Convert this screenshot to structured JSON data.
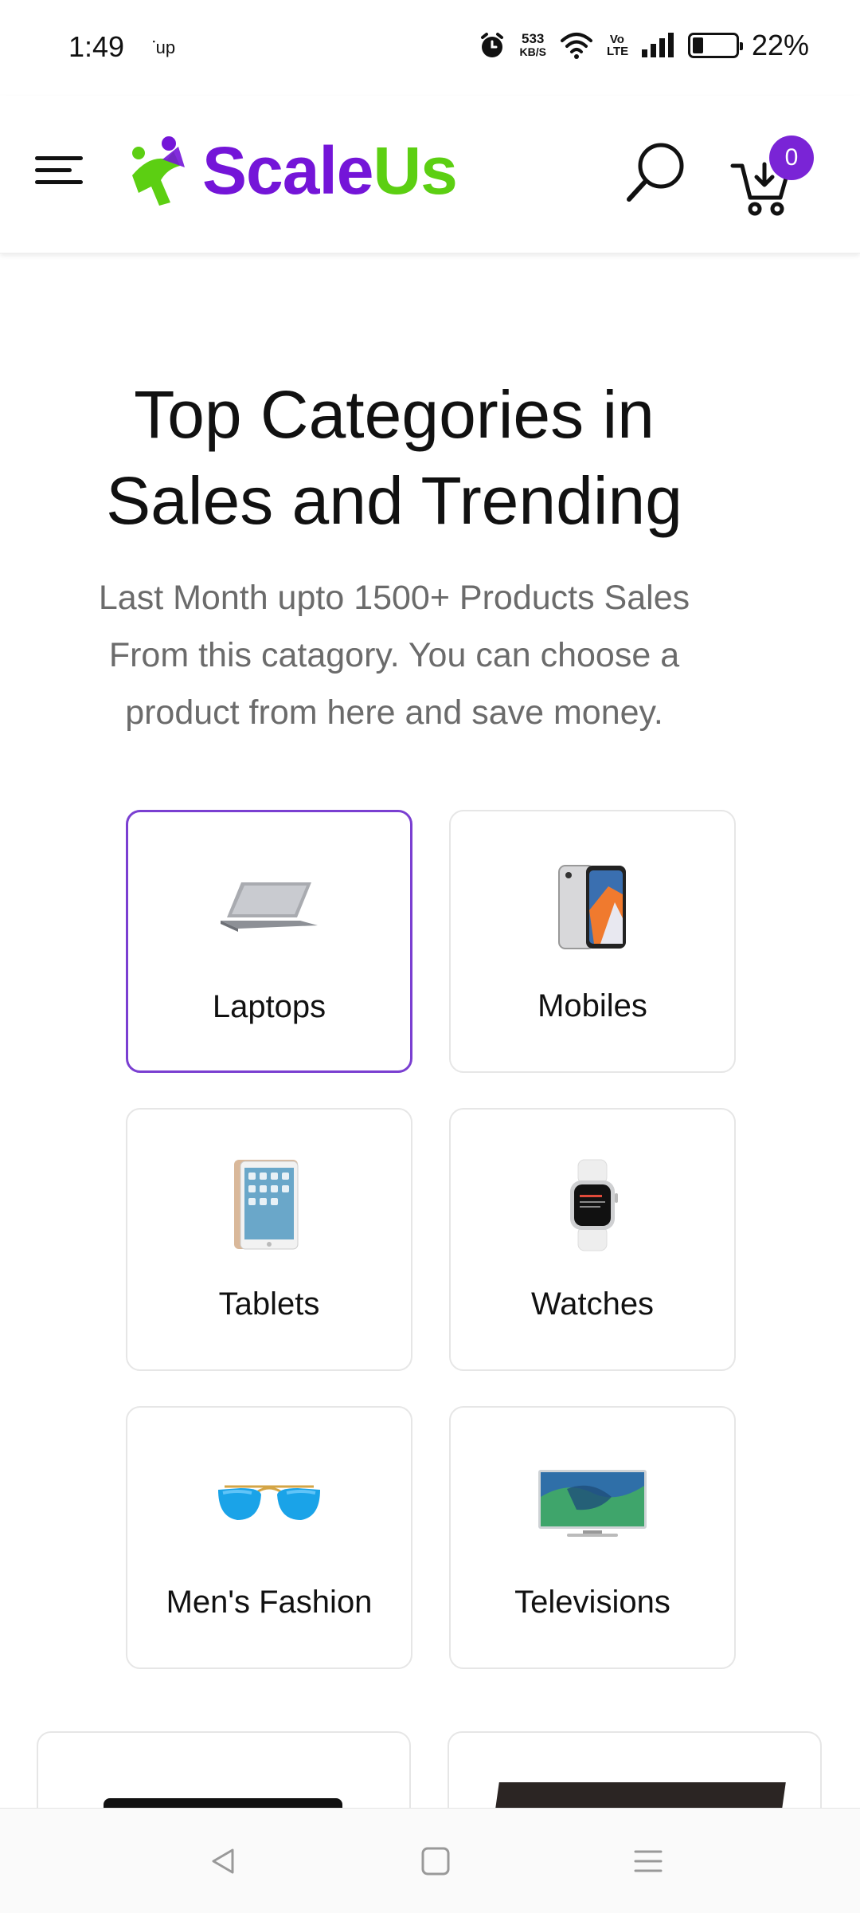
{
  "status_bar": {
    "time": "1:49",
    "up_label": "ᐝup",
    "speed_value": "533",
    "speed_unit": "KB/S",
    "volte": "Vo LTE",
    "battery_level": 0.22,
    "battery_percent": "22%"
  },
  "header": {
    "logo_part1": "Scale",
    "logo_part2": "Us",
    "cart_count": "0",
    "colors": {
      "brand_purple": "#7415d8",
      "brand_green": "#5ccf12",
      "badge": "#7a24d6"
    }
  },
  "section": {
    "title_line1": "Top Categories in",
    "title_line2": "Sales and Trending",
    "desc_line1": "Last Month upto 1500+ Products Sales",
    "desc_line2": "From this catagory. You can choose a",
    "desc_line3": "product from here and save money."
  },
  "categories": [
    {
      "label": "Laptops",
      "icon": "laptop-icon",
      "active": true
    },
    {
      "label": "Mobiles",
      "icon": "mobile-phone-icon",
      "active": false
    },
    {
      "label": "Tablets",
      "icon": "tablet-icon",
      "active": false
    },
    {
      "label": "Watches",
      "icon": "smartwatch-icon",
      "active": false
    },
    {
      "label": "Men's Fashion",
      "icon": "sunglasses-icon",
      "active": false
    },
    {
      "label": "Televisions",
      "icon": "television-icon",
      "active": false
    }
  ],
  "nav": {
    "back": "back-icon",
    "home": "home-icon",
    "menu": "recents-icon"
  }
}
